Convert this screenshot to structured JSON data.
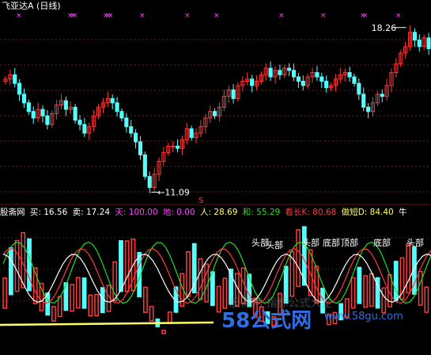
{
  "title": "飞亚达A (日线)",
  "price_labels": {
    "high": "18.26",
    "low": "11.09",
    "marker": "S"
  },
  "indicator_bar": {
    "name": "股斋网",
    "buy": "买: 16.56",
    "sell": "卖: 17.24",
    "tian": "天: 100.00",
    "di": "地: 0.00",
    "ren": "人: 28.69",
    "he": "和: 55.29",
    "kanzhang": "看长K: 80.68",
    "zuoduan": "做短D: 84.40",
    "niu": "牛"
  },
  "annotations": [
    {
      "text": "头部",
      "key": "a1"
    },
    {
      "text": "头部",
      "key": "a2"
    },
    {
      "text": "头部",
      "key": "a3"
    },
    {
      "text": "底部",
      "key": "a4"
    },
    {
      "text": "顶部",
      "key": "a5"
    },
    {
      "text": "底部",
      "key": "a6"
    },
    {
      "text": "头部",
      "key": "a7"
    }
  ],
  "watermark": {
    "main": "58公式网",
    "url": "www.58gu.com",
    "faint": "股斋网 指标公式大全"
  },
  "colors": {
    "background": "#000000",
    "up": "#ff3a3a",
    "down": "#54ffff",
    "grid": "#7a1a1a",
    "magenta": "#ff44ff",
    "yellow": "#ffff66",
    "green": "#22dd22",
    "white": "#ffffff"
  },
  "chart_data": {
    "type": "candlestick",
    "upper": {
      "closes": [
        16.1,
        16.3,
        15.9,
        15.4,
        15.0,
        14.6,
        14.3,
        14.7,
        14.4,
        14.0,
        14.5,
        14.9,
        15.1,
        14.7,
        14.8,
        14.2,
        14.0,
        13.6,
        13.9,
        14.4,
        14.8,
        15.0,
        15.2,
        15.0,
        14.6,
        14.3,
        13.9,
        13.6,
        13.2,
        12.6,
        11.6,
        11.09,
        11.7,
        12.3,
        12.7,
        13.0,
        13.0,
        12.9,
        13.3,
        13.8,
        13.4,
        13.6,
        13.9,
        14.3,
        14.6,
        14.4,
        14.8,
        15.3,
        15.6,
        15.2,
        15.8,
        16.0,
        16.1,
        15.8,
        16.0,
        16.3,
        16.6,
        16.2,
        16.5,
        16.3,
        16.6,
        16.5,
        16.2,
        16.0,
        15.8,
        16.2,
        16.4,
        16.2,
        16.0,
        15.7,
        15.8,
        16.1,
        16.3,
        16.4,
        16.2,
        15.9,
        15.4,
        14.8,
        14.6,
        15.0,
        15.4,
        15.3,
        15.8,
        16.4,
        16.8,
        17.3,
        17.6,
        18.26,
        17.9,
        17.6,
        18.0,
        17.5
      ],
      "high_label": 18.26,
      "low_label": 11.09
    },
    "lower": {
      "indicator_name": "股斋网",
      "values": {
        "buy": 16.56,
        "sell": 17.24,
        "tian": 100.0,
        "di": 0.0,
        "ren": 28.69,
        "he": 55.29,
        "kanzhang_k": 80.68,
        "zuoduan_d": 84.4
      }
    }
  }
}
